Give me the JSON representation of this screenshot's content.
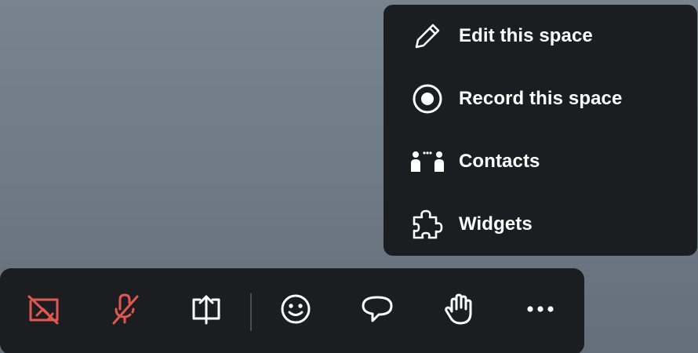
{
  "menu": {
    "items": [
      {
        "label": "Edit this space",
        "icon": "pencil-icon"
      },
      {
        "label": "Record this space",
        "icon": "record-icon"
      },
      {
        "label": "Contacts",
        "icon": "contacts-icon"
      },
      {
        "label": "Widgets",
        "icon": "puzzle-icon"
      }
    ]
  },
  "toolbar": {
    "buttons": [
      {
        "name": "camera-off-button",
        "icon": "camera-off-icon",
        "state": "off"
      },
      {
        "name": "mic-off-button",
        "icon": "mic-off-icon",
        "state": "off"
      },
      {
        "name": "share-screen-button",
        "icon": "share-screen-icon"
      },
      {
        "name": "reactions-button",
        "icon": "smiley-icon"
      },
      {
        "name": "chat-button",
        "icon": "chat-bubble-icon"
      },
      {
        "name": "raise-hand-button",
        "icon": "hand-icon"
      },
      {
        "name": "more-options-button",
        "icon": "more-icon"
      }
    ]
  },
  "colors": {
    "panel": "#1b1d20",
    "text": "#ffffff",
    "muted_red": "#e0584f"
  }
}
